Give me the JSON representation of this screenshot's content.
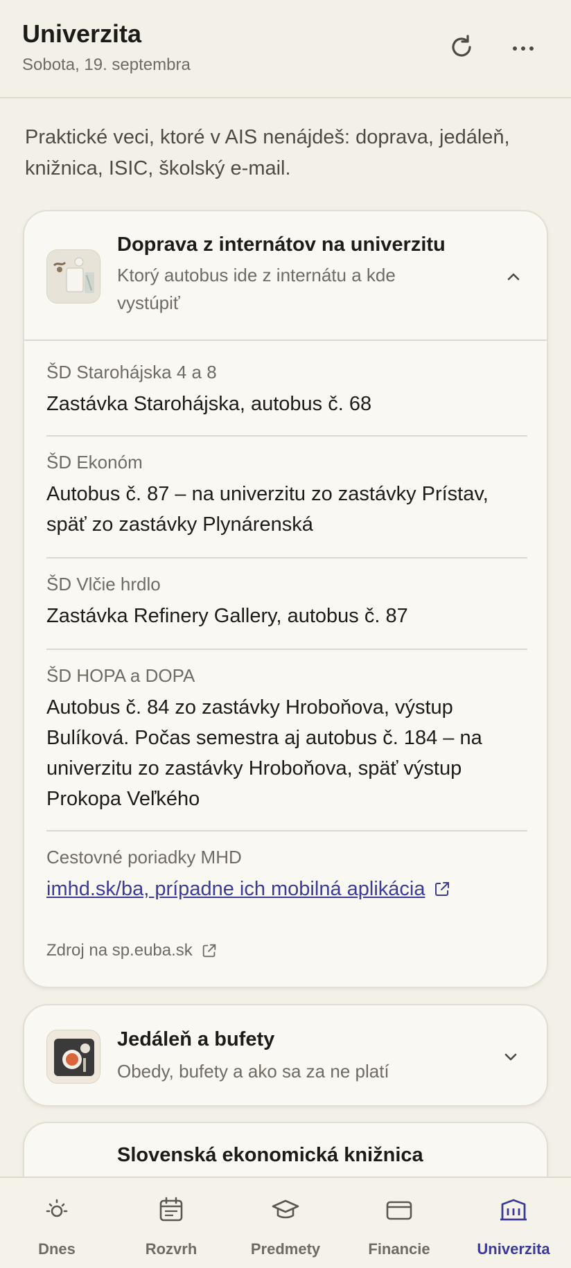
{
  "header": {
    "title": "Univerzita",
    "date": "Sobota, 19. septembra",
    "refresh_icon": "refresh-icon",
    "more_icon": "more-icon"
  },
  "intro": "Praktické veci, ktoré v AIS nenájdeš: doprava, jedáleň, knižnica, ISIC, školský e-mail.",
  "cards": {
    "transport": {
      "title": "Doprava z internátov na univerzitu",
      "subtitle": "Ktorý autobus ide z internátu a kde vystúpiť",
      "expanded": true,
      "items": [
        {
          "label": "ŠD Starohájska 4 a 8",
          "text": "Zastávka Starohájska, autobus č. 68"
        },
        {
          "label": "ŠD Ekonóm",
          "text": "Autobus č. 87 – na univerzitu zo zastávky Prístav, späť zo zastávky Plynárenská"
        },
        {
          "label": "ŠD Vlčie hrdlo",
          "text": "Zastávka Refinery Gallery, autobus č. 87"
        },
        {
          "label": "ŠD HOPA a DOPA",
          "text": "Autobus č. 84 zo zastávky Hroboňova, výstup Bulíková. Počas semestra aj autobus č. 184 – na univerzitu zo zastávky Hroboňova, späť výstup Prokopa Veľkého"
        },
        {
          "label": "Cestovné poriadky MHD",
          "link": "imhd.sk/ba, prípadne ich mobilná aplikácia"
        }
      ],
      "source": "Zdroj na sp.euba.sk"
    },
    "canteen": {
      "title": "Jedáleň a bufety",
      "subtitle": "Obedy, bufety a ako sa za ne platí",
      "expanded": false
    },
    "library": {
      "title": "Slovenská ekonomická knižnica"
    }
  },
  "nav": [
    {
      "label": "Dnes",
      "icon": "sun-icon",
      "active": false
    },
    {
      "label": "Rozvrh",
      "icon": "calendar-icon",
      "active": false
    },
    {
      "label": "Predmety",
      "icon": "graduation-cap-icon",
      "active": false
    },
    {
      "label": "Financie",
      "icon": "wallet-icon",
      "active": false
    },
    {
      "label": "Univerzita",
      "icon": "university-building-icon",
      "active": true
    }
  ],
  "colors": {
    "background": "#f3f0e8",
    "card": "#faf8f2",
    "accent": "#3b3a9c",
    "muted": "#6f6b62"
  }
}
